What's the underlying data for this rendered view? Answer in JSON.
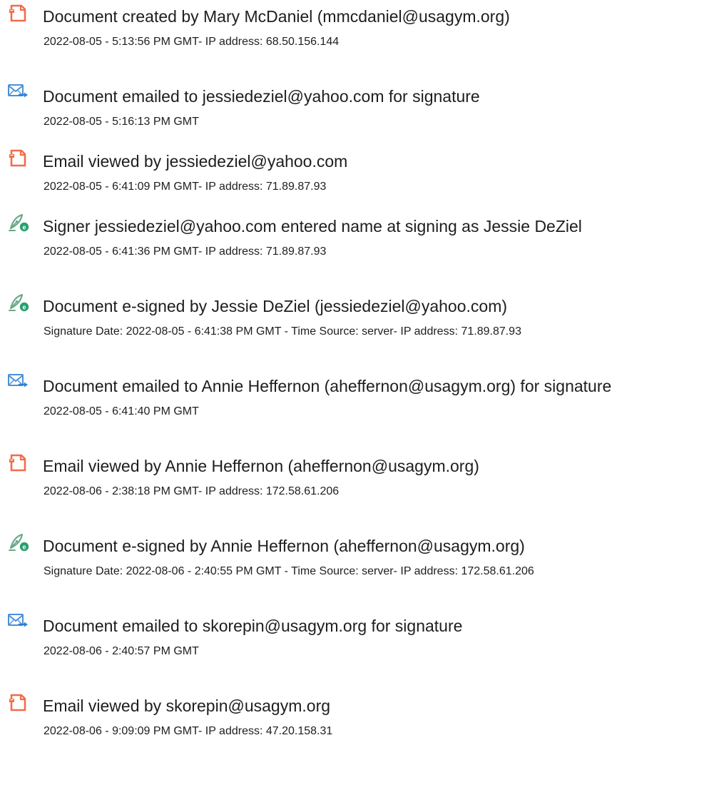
{
  "colors": {
    "document_icon": "#ee6e4b",
    "email_icon": "#4a90d9",
    "signature_icon": "#8ab5a0",
    "signature_badge": "#2aa072",
    "text": "#1e1e1e"
  },
  "events": [
    {
      "icon": "document-icon",
      "title": "Document created by Mary McDaniel (mmcdaniel@usagym.org)",
      "detail": "2022-08-05 - 5:13:56 PM GMT- IP address: 68.50.156.144"
    },
    {
      "icon": "email-icon",
      "title": "Document emailed to jessiedeziel@yahoo.com for signature",
      "detail": "2022-08-05 - 5:16:13 PM GMT"
    },
    {
      "icon": "document-icon",
      "title": "Email viewed by jessiedeziel@yahoo.com",
      "detail": "2022-08-05 - 6:41:09 PM GMT- IP address: 71.89.87.93"
    },
    {
      "icon": "signature-icon",
      "title": "Signer jessiedeziel@yahoo.com entered name at signing as Jessie DeZiel",
      "detail": "2022-08-05 - 6:41:36 PM GMT- IP address: 71.89.87.93"
    },
    {
      "icon": "signature-icon",
      "title": "Document e-signed by Jessie DeZiel (jessiedeziel@yahoo.com)",
      "detail": "Signature Date: 2022-08-05 - 6:41:38 PM GMT - Time Source: server- IP address: 71.89.87.93"
    },
    {
      "icon": "email-icon",
      "title": "Document emailed to Annie Heffernon (aheffernon@usagym.org) for signature",
      "detail": "2022-08-05 - 6:41:40 PM GMT"
    },
    {
      "icon": "document-icon",
      "title": "Email viewed by Annie Heffernon (aheffernon@usagym.org)",
      "detail": "2022-08-06 - 2:38:18 PM GMT- IP address: 172.58.61.206"
    },
    {
      "icon": "signature-icon",
      "title": "Document e-signed by Annie Heffernon (aheffernon@usagym.org)",
      "detail": "Signature Date: 2022-08-06 - 2:40:55 PM GMT - Time Source: server- IP address: 172.58.61.206"
    },
    {
      "icon": "email-icon",
      "title": "Document emailed to skorepin@usagym.org for signature",
      "detail": "2022-08-06 - 2:40:57 PM GMT"
    },
    {
      "icon": "document-icon",
      "title": "Email viewed by skorepin@usagym.org",
      "detail": "2022-08-06 - 9:09:09 PM GMT- IP address: 47.20.158.31"
    }
  ]
}
